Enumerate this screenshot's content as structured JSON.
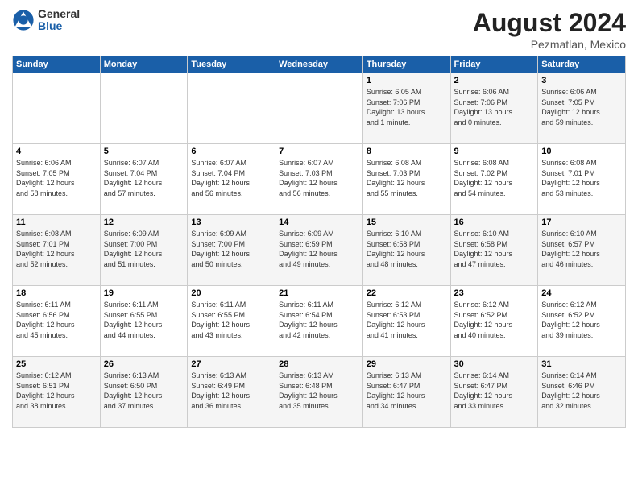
{
  "logo": {
    "general": "General",
    "blue": "Blue"
  },
  "title": {
    "month": "August 2024",
    "location": "Pezmatlan, Mexico"
  },
  "days_of_week": [
    "Sunday",
    "Monday",
    "Tuesday",
    "Wednesday",
    "Thursday",
    "Friday",
    "Saturday"
  ],
  "weeks": [
    [
      {
        "day": "",
        "info": ""
      },
      {
        "day": "",
        "info": ""
      },
      {
        "day": "",
        "info": ""
      },
      {
        "day": "",
        "info": ""
      },
      {
        "day": "1",
        "info": "Sunrise: 6:05 AM\nSunset: 7:06 PM\nDaylight: 13 hours\nand 1 minute."
      },
      {
        "day": "2",
        "info": "Sunrise: 6:06 AM\nSunset: 7:06 PM\nDaylight: 13 hours\nand 0 minutes."
      },
      {
        "day": "3",
        "info": "Sunrise: 6:06 AM\nSunset: 7:05 PM\nDaylight: 12 hours\nand 59 minutes."
      }
    ],
    [
      {
        "day": "4",
        "info": "Sunrise: 6:06 AM\nSunset: 7:05 PM\nDaylight: 12 hours\nand 58 minutes."
      },
      {
        "day": "5",
        "info": "Sunrise: 6:07 AM\nSunset: 7:04 PM\nDaylight: 12 hours\nand 57 minutes."
      },
      {
        "day": "6",
        "info": "Sunrise: 6:07 AM\nSunset: 7:04 PM\nDaylight: 12 hours\nand 56 minutes."
      },
      {
        "day": "7",
        "info": "Sunrise: 6:07 AM\nSunset: 7:03 PM\nDaylight: 12 hours\nand 56 minutes."
      },
      {
        "day": "8",
        "info": "Sunrise: 6:08 AM\nSunset: 7:03 PM\nDaylight: 12 hours\nand 55 minutes."
      },
      {
        "day": "9",
        "info": "Sunrise: 6:08 AM\nSunset: 7:02 PM\nDaylight: 12 hours\nand 54 minutes."
      },
      {
        "day": "10",
        "info": "Sunrise: 6:08 AM\nSunset: 7:01 PM\nDaylight: 12 hours\nand 53 minutes."
      }
    ],
    [
      {
        "day": "11",
        "info": "Sunrise: 6:08 AM\nSunset: 7:01 PM\nDaylight: 12 hours\nand 52 minutes."
      },
      {
        "day": "12",
        "info": "Sunrise: 6:09 AM\nSunset: 7:00 PM\nDaylight: 12 hours\nand 51 minutes."
      },
      {
        "day": "13",
        "info": "Sunrise: 6:09 AM\nSunset: 7:00 PM\nDaylight: 12 hours\nand 50 minutes."
      },
      {
        "day": "14",
        "info": "Sunrise: 6:09 AM\nSunset: 6:59 PM\nDaylight: 12 hours\nand 49 minutes."
      },
      {
        "day": "15",
        "info": "Sunrise: 6:10 AM\nSunset: 6:58 PM\nDaylight: 12 hours\nand 48 minutes."
      },
      {
        "day": "16",
        "info": "Sunrise: 6:10 AM\nSunset: 6:58 PM\nDaylight: 12 hours\nand 47 minutes."
      },
      {
        "day": "17",
        "info": "Sunrise: 6:10 AM\nSunset: 6:57 PM\nDaylight: 12 hours\nand 46 minutes."
      }
    ],
    [
      {
        "day": "18",
        "info": "Sunrise: 6:11 AM\nSunset: 6:56 PM\nDaylight: 12 hours\nand 45 minutes."
      },
      {
        "day": "19",
        "info": "Sunrise: 6:11 AM\nSunset: 6:55 PM\nDaylight: 12 hours\nand 44 minutes."
      },
      {
        "day": "20",
        "info": "Sunrise: 6:11 AM\nSunset: 6:55 PM\nDaylight: 12 hours\nand 43 minutes."
      },
      {
        "day": "21",
        "info": "Sunrise: 6:11 AM\nSunset: 6:54 PM\nDaylight: 12 hours\nand 42 minutes."
      },
      {
        "day": "22",
        "info": "Sunrise: 6:12 AM\nSunset: 6:53 PM\nDaylight: 12 hours\nand 41 minutes."
      },
      {
        "day": "23",
        "info": "Sunrise: 6:12 AM\nSunset: 6:52 PM\nDaylight: 12 hours\nand 40 minutes."
      },
      {
        "day": "24",
        "info": "Sunrise: 6:12 AM\nSunset: 6:52 PM\nDaylight: 12 hours\nand 39 minutes."
      }
    ],
    [
      {
        "day": "25",
        "info": "Sunrise: 6:12 AM\nSunset: 6:51 PM\nDaylight: 12 hours\nand 38 minutes."
      },
      {
        "day": "26",
        "info": "Sunrise: 6:13 AM\nSunset: 6:50 PM\nDaylight: 12 hours\nand 37 minutes."
      },
      {
        "day": "27",
        "info": "Sunrise: 6:13 AM\nSunset: 6:49 PM\nDaylight: 12 hours\nand 36 minutes."
      },
      {
        "day": "28",
        "info": "Sunrise: 6:13 AM\nSunset: 6:48 PM\nDaylight: 12 hours\nand 35 minutes."
      },
      {
        "day": "29",
        "info": "Sunrise: 6:13 AM\nSunset: 6:47 PM\nDaylight: 12 hours\nand 34 minutes."
      },
      {
        "day": "30",
        "info": "Sunrise: 6:14 AM\nSunset: 6:47 PM\nDaylight: 12 hours\nand 33 minutes."
      },
      {
        "day": "31",
        "info": "Sunrise: 6:14 AM\nSunset: 6:46 PM\nDaylight: 12 hours\nand 32 minutes."
      }
    ]
  ]
}
